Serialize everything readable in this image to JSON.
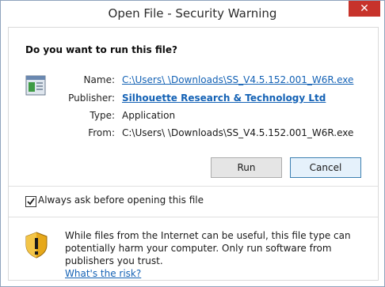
{
  "window": {
    "title": "Open File - Security Warning",
    "close_label": "✕"
  },
  "dialog": {
    "question": "Do you want to run this file?",
    "fields": {
      "name_label": "Name:",
      "name_value": "C:\\Users\\            \\Downloads\\SS_V4.5.152.001_W6R.exe",
      "publisher_label": "Publisher:",
      "publisher_value": "Silhouette Research & Technology Ltd",
      "type_label": "Type:",
      "type_value": "Application",
      "from_label": "From:",
      "from_value": "C:\\Users\\            \\Downloads\\SS_V4.5.152.001_W6R.exe"
    },
    "buttons": {
      "run": "Run",
      "cancel": "Cancel"
    },
    "checkbox": {
      "label": "Always ask before opening this file",
      "checked": true
    },
    "warning": {
      "text": "While files from the Internet can be useful, this file type can potentially harm your computer. Only run software from publishers you trust.",
      "link": "What's the risk?"
    }
  },
  "colors": {
    "accent_link": "#1462b5",
    "close_button": "#c7332b",
    "border": "#8fa3bd"
  },
  "icons": [
    "application-icon",
    "close-icon",
    "checkmark-icon",
    "shield-warning-icon"
  ]
}
